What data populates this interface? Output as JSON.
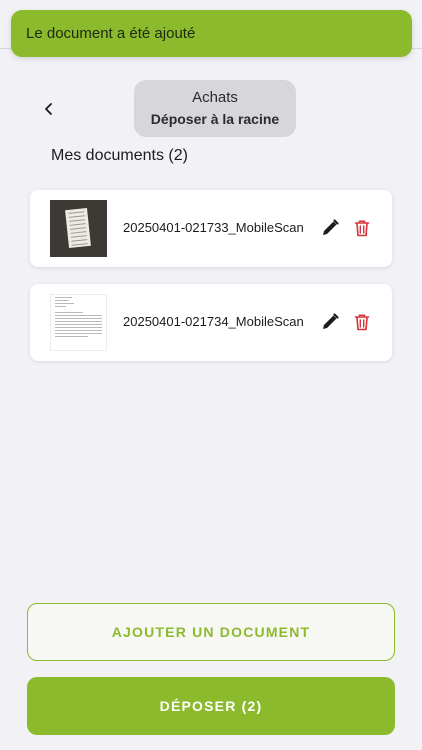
{
  "toast": {
    "message": "Le document a été ajouté"
  },
  "header": {
    "back_icon": "chevron-left-icon",
    "folder_name": "Achats",
    "folder_action": "Déposer à la racine"
  },
  "documents": {
    "title": "Mes documents (2)",
    "items": [
      {
        "name": "20250401-021733_MobileScan",
        "thumbnail": "scanned-receipt-photo",
        "edit_icon": "pencil-icon",
        "delete_icon": "trash-icon"
      },
      {
        "name": "20250401-021734_MobileScan",
        "thumbnail": "scanned-letter-page",
        "edit_icon": "pencil-icon",
        "delete_icon": "trash-icon"
      }
    ]
  },
  "actions": {
    "add_label": "AJOUTER UN DOCUMENT",
    "submit_label": "DÉPOSER (2)"
  },
  "colors": {
    "accent": "#8cba2d",
    "delete": "#d8323c",
    "background": "#f2f2f6"
  }
}
